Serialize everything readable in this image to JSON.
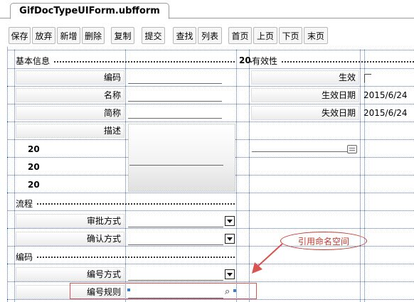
{
  "document_tab": {
    "title": "GifDocTypeUIForm.ubfform"
  },
  "toolbar": {
    "save": "保存",
    "discard": "放弃",
    "add": "新增",
    "delete": "删除",
    "copy": "复制",
    "submit": "提交",
    "find": "查找",
    "list": "列表",
    "first": "首页",
    "prev": "上页",
    "next": "下页",
    "last": "末页"
  },
  "sections": {
    "basic": "基本信息",
    "validity": "有效性",
    "flow": "流程",
    "code": "编码",
    "validity_num": "20"
  },
  "basic_fields": {
    "code": "编码",
    "name": "名称",
    "short_name": "简称",
    "description": "描述",
    "num1": "20",
    "num2": "20",
    "num3": "20"
  },
  "validity_fields": {
    "effective": "生效",
    "effective_date": "生效日期",
    "effective_date_value": "2015/6/24",
    "expire_date": "失效日期",
    "expire_date_value": "2015/6/24"
  },
  "flow_fields": {
    "approval_mode": "审批方式",
    "confirm_mode": "确认方式"
  },
  "code_fields": {
    "numbering_mode": "编号方式",
    "numbering_rule": "编号规则"
  },
  "annotation": {
    "callout_text": "引用命名空间",
    "arrow_color": "#d9534f"
  }
}
